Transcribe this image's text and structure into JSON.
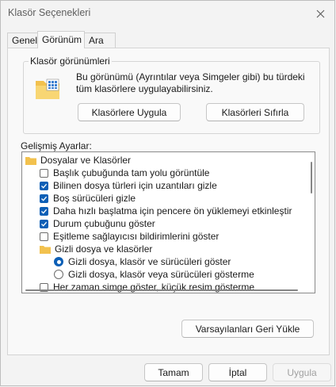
{
  "window": {
    "title": "Klasör Seçenekleri"
  },
  "tabs": [
    {
      "label": "Genel"
    },
    {
      "label": "Görünüm"
    },
    {
      "label": "Ara"
    }
  ],
  "folder_views": {
    "title": "Klasör görünümleri",
    "description": "Bu görünümü (Ayrıntılar veya Simgeler gibi) bu türdeki tüm klasörlere uygulayabilirsiniz.",
    "apply_label": "Klasörlere Uygula",
    "reset_label": "Klasörleri Sıfırla"
  },
  "advanced": {
    "label": "Gelişmiş Ayarlar:",
    "items": [
      {
        "type": "folder",
        "label": "Dosyalar ve Klasörler"
      },
      {
        "type": "checkbox",
        "checked": false,
        "label": "Başlık çubuğunda tam yolu görüntüle"
      },
      {
        "type": "checkbox",
        "checked": true,
        "label": "Bilinen dosya türleri için uzantıları gizle"
      },
      {
        "type": "checkbox",
        "checked": true,
        "label": "Boş sürücüleri gizle"
      },
      {
        "type": "checkbox",
        "checked": true,
        "label": "Daha hızlı başlatma için pencere ön yüklemeyi etkinleştir"
      },
      {
        "type": "checkbox",
        "checked": true,
        "label": "Durum çubuğunu göster"
      },
      {
        "type": "checkbox",
        "checked": false,
        "label": "Eşitleme sağlayıcısı bildirimlerini göster"
      },
      {
        "type": "folder",
        "label": "Gizli dosya ve klasörler"
      },
      {
        "type": "radio",
        "checked": true,
        "label": "Gizli dosya, klasör ve sürücüleri göster"
      },
      {
        "type": "radio",
        "checked": false,
        "label": "Gizli dosya, klasör veya sürücüleri gösterme"
      },
      {
        "type": "checkbox",
        "checked": false,
        "label": "Her zaman simge göster, küçük resim gösterme"
      }
    ]
  },
  "restore_defaults_label": "Varsayılanları Geri Yükle",
  "footer": {
    "ok_label": "Tamam",
    "cancel_label": "İptal",
    "apply_label": "Uygula"
  },
  "colors": {
    "accent": "#0c5fb6",
    "folder": "#f2c14e"
  }
}
